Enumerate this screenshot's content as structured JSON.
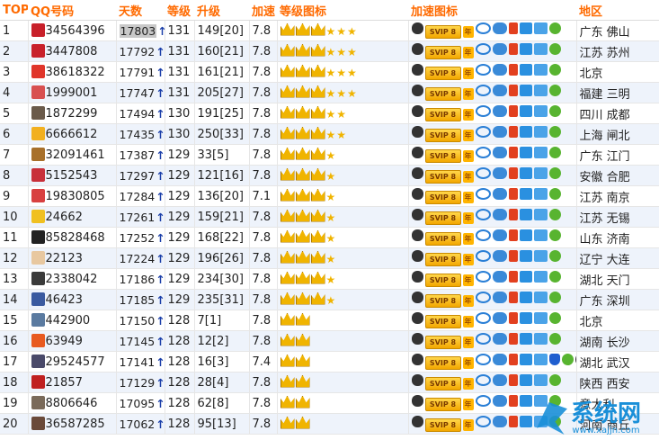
{
  "headers": {
    "top": "TOP",
    "qq": "QQ号码",
    "days": "天数",
    "level": "等级",
    "upgrade": "升级",
    "speed": "加速",
    "level_icon": "等级图标",
    "accel_icon": "加速图标",
    "region": "地区"
  },
  "accel_labels": {
    "svip": "SVIP 8",
    "year": "年"
  },
  "arrow": "↑",
  "rows": [
    {
      "top": "1",
      "qq": "34564396",
      "days": "17803",
      "level": "131",
      "upgrade": "149[20]",
      "speed": "7.8",
      "crowns": 3,
      "stars": 3,
      "region": "广东 佛山",
      "avatar": "#c8202a",
      "extra": false
    },
    {
      "top": "2",
      "qq": "3447808",
      "days": "17792",
      "level": "131",
      "upgrade": "160[21]",
      "speed": "7.8",
      "crowns": 3,
      "stars": 3,
      "region": "江苏 苏州",
      "avatar": "#c8202a",
      "extra": false
    },
    {
      "top": "3",
      "qq": "38618322",
      "days": "17791",
      "level": "131",
      "upgrade": "161[21]",
      "speed": "7.8",
      "crowns": 3,
      "stars": 3,
      "region": "北京",
      "avatar": "#e0352a",
      "extra": false
    },
    {
      "top": "4",
      "qq": "1999001",
      "days": "17747",
      "level": "131",
      "upgrade": "205[27]",
      "speed": "7.8",
      "crowns": 3,
      "stars": 3,
      "region": "福建 三明",
      "avatar": "#d85050",
      "extra": false
    },
    {
      "top": "5",
      "qq": "1872299",
      "days": "17494",
      "level": "130",
      "upgrade": "191[25]",
      "speed": "7.8",
      "crowns": 3,
      "stars": 2,
      "region": "四川 成都",
      "avatar": "#6a5a4a",
      "extra": false
    },
    {
      "top": "6",
      "qq": "6666612",
      "days": "17435",
      "level": "130",
      "upgrade": "250[33]",
      "speed": "7.8",
      "crowns": 3,
      "stars": 2,
      "region": "上海 闸北",
      "avatar": "#f2b020",
      "extra": false
    },
    {
      "top": "7",
      "qq": "32091461",
      "days": "17387",
      "level": "129",
      "upgrade": "33[5]",
      "speed": "7.8",
      "crowns": 3,
      "stars": 1,
      "region": "广东 江门",
      "avatar": "#a8702a",
      "extra": false
    },
    {
      "top": "8",
      "qq": "5152543",
      "days": "17297",
      "level": "129",
      "upgrade": "121[16]",
      "speed": "7.8",
      "crowns": 3,
      "stars": 1,
      "region": "安徽 合肥",
      "avatar": "#c8303a",
      "extra": false
    },
    {
      "top": "9",
      "qq": "19830805",
      "days": "17284",
      "level": "129",
      "upgrade": "136[20]",
      "speed": "7.1",
      "crowns": 3,
      "stars": 1,
      "region": "江苏 南京",
      "avatar": "#d84040",
      "extra": false
    },
    {
      "top": "10",
      "qq": "24662",
      "days": "17261",
      "level": "129",
      "upgrade": "159[21]",
      "speed": "7.8",
      "crowns": 3,
      "stars": 1,
      "region": "江苏 无锡",
      "avatar": "#f0c020",
      "extra": false
    },
    {
      "top": "11",
      "qq": "85828468",
      "days": "17252",
      "level": "129",
      "upgrade": "168[22]",
      "speed": "7.8",
      "crowns": 3,
      "stars": 1,
      "region": "山东 济南",
      "avatar": "#222222",
      "extra": false
    },
    {
      "top": "12",
      "qq": "22123",
      "days": "17224",
      "level": "129",
      "upgrade": "196[26]",
      "speed": "7.8",
      "crowns": 3,
      "stars": 1,
      "region": "辽宁 大连",
      "avatar": "#e8c8a0",
      "extra": false
    },
    {
      "top": "13",
      "qq": "2338042",
      "days": "17186",
      "level": "129",
      "upgrade": "234[30]",
      "speed": "7.8",
      "crowns": 3,
      "stars": 1,
      "region": "湖北 天门",
      "avatar": "#3a3a3a",
      "extra": false
    },
    {
      "top": "14",
      "qq": "46423",
      "days": "17185",
      "level": "129",
      "upgrade": "235[31]",
      "speed": "7.8",
      "crowns": 3,
      "stars": 1,
      "region": "广东 深圳",
      "avatar": "#3a5aa0",
      "extra": false
    },
    {
      "top": "15",
      "qq": "442900",
      "days": "17150",
      "level": "128",
      "upgrade": "7[1]",
      "speed": "7.8",
      "crowns": 2,
      "stars": 0,
      "region": "北京",
      "avatar": "#5a7aa0",
      "extra": false
    },
    {
      "top": "16",
      "qq": "63949",
      "days": "17145",
      "level": "128",
      "upgrade": "12[2]",
      "speed": "7.8",
      "crowns": 2,
      "stars": 0,
      "region": "湖南 长沙",
      "avatar": "#e85a20",
      "extra": false
    },
    {
      "top": "17",
      "qq": "29524577",
      "days": "17141",
      "level": "128",
      "upgrade": "16[3]",
      "speed": "7.4",
      "crowns": 2,
      "stars": 0,
      "region": "湖北 武汉",
      "avatar": "#4a4a6a",
      "extra": true
    },
    {
      "top": "18",
      "qq": "21857",
      "days": "17129",
      "level": "128",
      "upgrade": "28[4]",
      "speed": "7.8",
      "crowns": 2,
      "stars": 0,
      "region": "陕西 西安",
      "avatar": "#c02020",
      "extra": false
    },
    {
      "top": "19",
      "qq": "8806646",
      "days": "17095",
      "level": "128",
      "upgrade": "62[8]",
      "speed": "7.8",
      "crowns": 2,
      "stars": 0,
      "region": "意大利",
      "avatar": "#7a6a5a",
      "extra": false
    },
    {
      "top": "20",
      "qq": "36587285",
      "days": "17062",
      "level": "128",
      "upgrade": "95[13]",
      "speed": "7.8",
      "crowns": 2,
      "stars": 0,
      "region": "河南 商丘",
      "avatar": "#6a4a3a",
      "extra": false
    }
  ],
  "watermark": {
    "logo": "系统网",
    "url": "www.xajjn.com"
  },
  "colors": {
    "header": "#ff6a00",
    "row_alt": "#eef3fb",
    "arrow": "#1a3ea8",
    "crown": "#f0b400"
  }
}
